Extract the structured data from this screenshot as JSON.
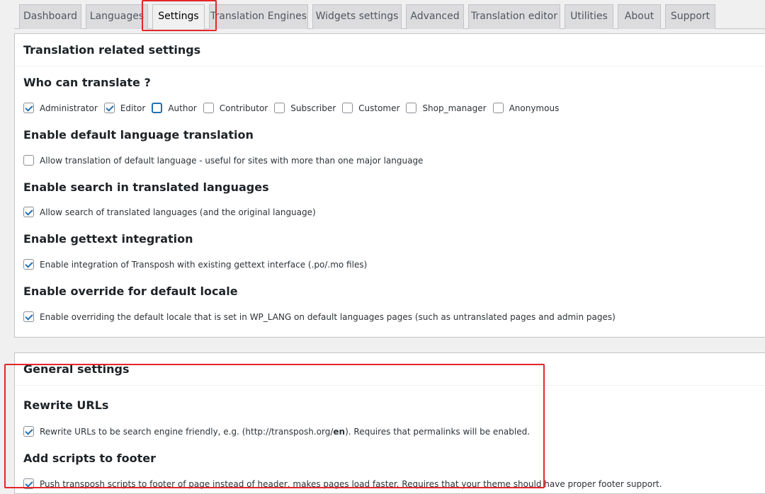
{
  "tabs": [
    {
      "label": "Dashboard",
      "active": false
    },
    {
      "label": "Languages",
      "active": false
    },
    {
      "label": "Settings",
      "active": true
    },
    {
      "label": "Translation Engines",
      "active": false
    },
    {
      "label": "Widgets settings",
      "active": false
    },
    {
      "label": "Advanced",
      "active": false
    },
    {
      "label": "Translation editor",
      "active": false
    },
    {
      "label": "Utilities",
      "active": false
    },
    {
      "label": "About",
      "active": false
    },
    {
      "label": "Support",
      "active": false
    }
  ],
  "translation_panel": {
    "title": "Translation related settings",
    "who_can_translate": {
      "title": "Who can translate ?",
      "roles": [
        {
          "label": "Administrator",
          "checked": true
        },
        {
          "label": "Editor",
          "checked": true
        },
        {
          "label": "Author",
          "checked": false
        },
        {
          "label": "Contributor",
          "checked": false
        },
        {
          "label": "Subscriber",
          "checked": false
        },
        {
          "label": "Customer",
          "checked": false
        },
        {
          "label": "Shop_manager",
          "checked": false
        },
        {
          "label": "Anonymous",
          "checked": false
        }
      ]
    },
    "default_language": {
      "title": "Enable default language translation",
      "label": "Allow translation of default language - useful for sites with more than one major language",
      "checked": false
    },
    "search": {
      "title": "Enable search in translated languages",
      "label": "Allow search of translated languages (and the original language)",
      "checked": true
    },
    "gettext": {
      "title": "Enable gettext integration",
      "label": "Enable integration of Transposh with existing gettext interface (.po/.mo files)",
      "checked": true
    },
    "locale": {
      "title": "Enable override for default locale",
      "label": "Enable overriding the default locale that is set in WP_LANG on default languages pages (such as untranslated pages and admin pages)",
      "checked": true
    }
  },
  "general_panel": {
    "title": "General settings",
    "rewrite": {
      "title": "Rewrite URLs",
      "label_pre": "Rewrite URLs to be search engine friendly, e.g. (http://transposh.org/",
      "label_bold": "en",
      "label_post": "). Requires that permalinks will be enabled.",
      "checked": true
    },
    "footer": {
      "title": "Add scripts to footer",
      "label": "Push transposh scripts to footer of page instead of header, makes pages load faster. Requires that your theme should have proper footer support.",
      "checked": true
    }
  },
  "colors": {
    "highlight": "#e3262a",
    "accent": "#2271b1"
  }
}
